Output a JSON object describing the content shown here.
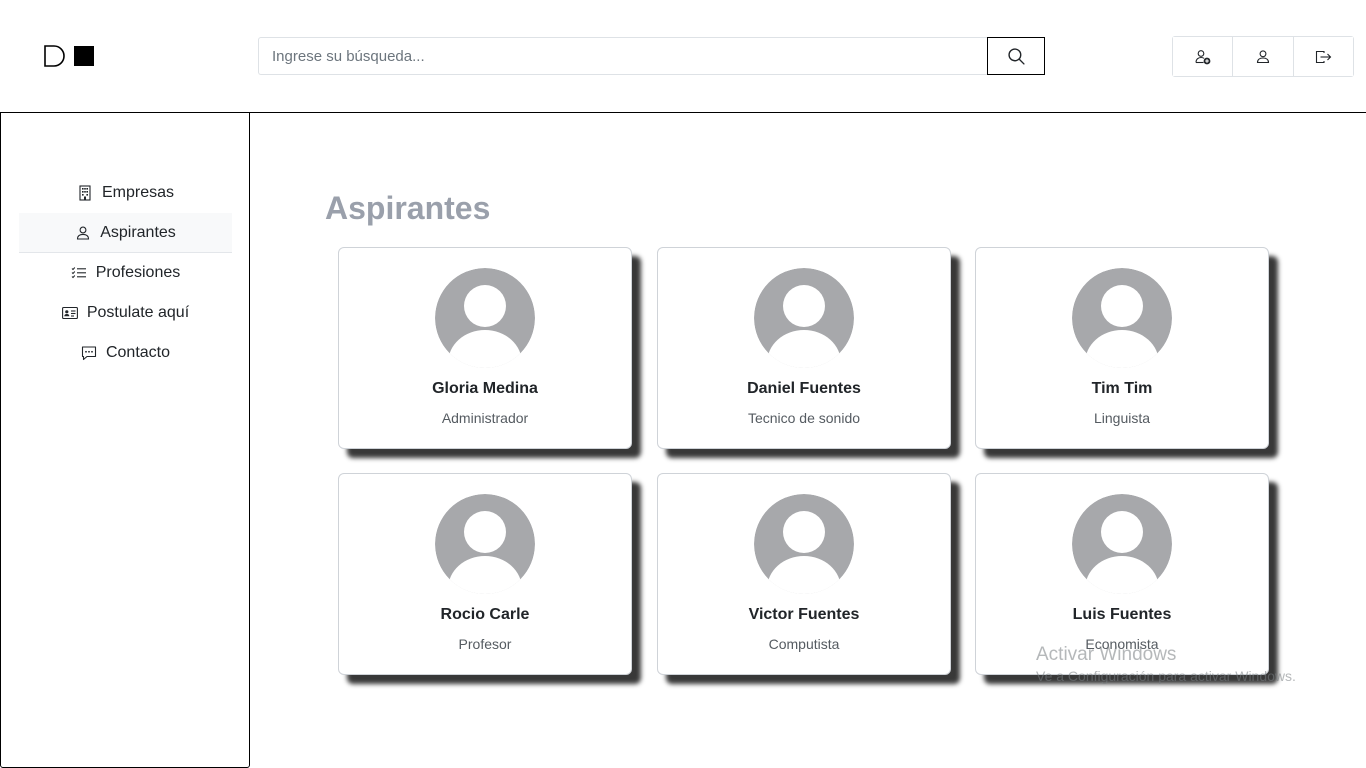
{
  "header": {
    "search": {
      "placeholder": "Ingrese su búsqueda..."
    },
    "actions": [
      {
        "icon": "add-user-icon"
      },
      {
        "icon": "user-icon"
      },
      {
        "icon": "logout-icon"
      }
    ]
  },
  "sidebar": {
    "items": [
      {
        "label": "Empresas",
        "icon": "building-icon",
        "active": false
      },
      {
        "label": "Aspirantes",
        "icon": "person-icon",
        "active": true
      },
      {
        "label": "Profesiones",
        "icon": "list-icon",
        "active": false
      },
      {
        "label": "Postulate aquí",
        "icon": "id-card-icon",
        "active": false
      },
      {
        "label": "Contacto",
        "icon": "chat-icon",
        "active": false
      }
    ]
  },
  "main": {
    "title": "Aspirantes",
    "cards": [
      {
        "name": "Gloria Medina",
        "role": "Administrador"
      },
      {
        "name": "Daniel Fuentes",
        "role": "Tecnico de sonido"
      },
      {
        "name": "Tim Tim",
        "role": "Linguista"
      },
      {
        "name": "Rocio Carle",
        "role": "Profesor"
      },
      {
        "name": "Victor Fuentes",
        "role": "Computista"
      },
      {
        "name": "Luis Fuentes",
        "role": "Economista"
      }
    ]
  },
  "watermark": {
    "title": "Activar Windows",
    "subtitle": "Ve a Configuración para activar Windows."
  },
  "colors": {
    "title": "#9aa0ab",
    "avatar": "#a7a8ab",
    "border": "#000000"
  }
}
